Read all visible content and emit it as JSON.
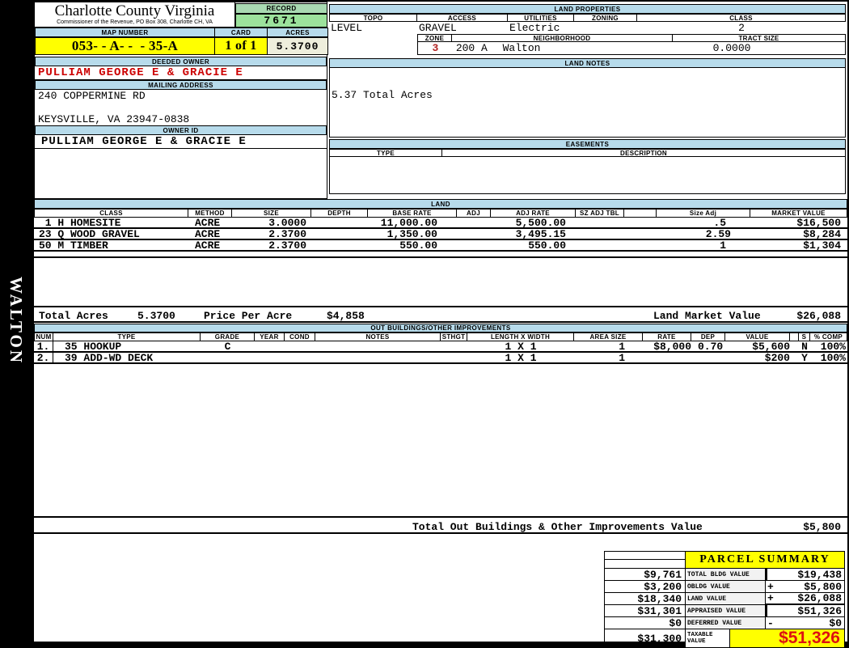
{
  "sidebar": {
    "vertical_label": "WALTON"
  },
  "header": {
    "county": "Charlotte County Virginia",
    "commissioner_line": "Commissioner of the Revenue, PO Box 308, Charlotte CH, VA",
    "record_label": "RECORD",
    "record_value": "7671",
    "map_number_label": "MAP NUMBER",
    "map_number_value": "053- - A- -  - 35-A",
    "card_label": "CARD",
    "card_value": "1 of 1",
    "acres_label": "ACRES",
    "acres_value": "5.3700"
  },
  "owner": {
    "deeded_owner_label": "DEEDED OWNER",
    "deeded_owner": "PULLIAM GEORGE E & GRACIE E",
    "mailing_address_label": "MAILING ADDRESS",
    "address_line1": "240 COPPERMINE RD",
    "address_line2": "KEYSVILLE, VA 23947-0838",
    "owner_id_label": "OWNER ID",
    "owner_id": "PULLIAM GEORGE E & GRACIE E"
  },
  "land_properties": {
    "title": "LAND PROPERTIES",
    "topo_label": "TOPO",
    "topo": "LEVEL",
    "access_label": "ACCESS",
    "access": "GRAVEL",
    "utilities_label": "UTILITIES",
    "utilities": "Electric",
    "zoning_label": "ZONING",
    "zoning": "",
    "class_label": "CLASS",
    "class": "2",
    "zone_label": "ZONE",
    "zone": "3",
    "zone_area": "200 A",
    "neighborhood_label": "NEIGHBORHOOD",
    "neighborhood": "Walton",
    "tract_size_label": "TRACT SIZE",
    "tract_size": "0.0000"
  },
  "land_notes": {
    "title": "LAND NOTES",
    "note": "5.37 Total Acres"
  },
  "easements": {
    "title": "EASEMENTS",
    "type_label": "TYPE",
    "description_label": "DESCRIPTION"
  },
  "land": {
    "title": "LAND",
    "columns": [
      "CLASS",
      "METHOD",
      "SIZE",
      "DEPTH",
      "BASE RATE",
      "ADJ",
      "ADJ RATE",
      "SZ ADJ TBL",
      "",
      "Size Adj",
      "MARKET VALUE"
    ],
    "rows": [
      {
        "class": " 1 H HOMESITE",
        "method": "ACRE",
        "size": "3.0000",
        "depth": "",
        "base_rate": "11,000.00",
        "adj": "",
        "adj_rate": "5,500.00",
        "sz_adj_tbl": "",
        "size_adj": ".5",
        "market_value": "$16,500"
      },
      {
        "class": "23 Q WOOD GRAVEL",
        "method": "ACRE",
        "size": "2.3700",
        "depth": "",
        "base_rate": "1,350.00",
        "adj": "",
        "adj_rate": "3,495.15",
        "sz_adj_tbl": "",
        "size_adj": "2.59",
        "market_value": "$8,284"
      },
      {
        "class": "50 M TIMBER",
        "method": "ACRE",
        "size": "2.3700",
        "depth": "",
        "base_rate": "550.00",
        "adj": "",
        "adj_rate": "550.00",
        "sz_adj_tbl": "",
        "size_adj": "1",
        "market_value": "$1,304"
      }
    ],
    "totals": {
      "total_acres_label": "Total Acres",
      "total_acres": "5.3700",
      "price_per_acre_label": "Price Per Acre",
      "price_per_acre": "$4,858",
      "land_market_value_label": "Land Market Value",
      "land_market_value": "$26,088"
    }
  },
  "out_buildings": {
    "title": "OUT BUILDINGS/OTHER IMPROVEMENTS",
    "columns": [
      "NUM",
      "TYPE",
      "GRADE",
      "YEAR",
      "COND",
      "NOTES",
      "STHGT",
      "LENGTH X WIDTH",
      "AREA SIZE",
      "RATE",
      "DEP",
      "VALUE",
      "",
      "S",
      "% COMP"
    ],
    "rows": [
      {
        "num": "1.",
        "type": "35 HOOKUP",
        "grade": "C",
        "year": "",
        "cond": "",
        "notes": "",
        "sthgt": "",
        "lxw": "1 X 1",
        "area_size": "1",
        "rate": "$8,000",
        "dep": "0.70",
        "value": "$5,600",
        "s": "N",
        "comp": "100%"
      },
      {
        "num": "2.",
        "type": "39 ADD-WD DECK",
        "grade": "",
        "year": "",
        "cond": "",
        "notes": "",
        "sthgt": "",
        "lxw": "1 X 1",
        "area_size": "1",
        "rate": "",
        "dep": "",
        "value": "$200",
        "s": "Y",
        "comp": "100%"
      }
    ],
    "total_label": "Total Out Buildings & Other Improvements Value",
    "total_value": "$5,800"
  },
  "parcel_summary": {
    "title": "PARCEL SUMMARY",
    "rows": [
      {
        "prior": "$9,761",
        "label": "TOTAL BLDG VALUE",
        "sign": "",
        "value": "$19,438"
      },
      {
        "prior": "$3,200",
        "label": "OBLDG VALUE",
        "sign": "+",
        "value": "$5,800"
      },
      {
        "prior": "$18,340",
        "label": "LAND VALUE",
        "sign": "+",
        "value": "$26,088"
      },
      {
        "prior": "$31,301",
        "label": "APPRAISED VALUE",
        "sign": "",
        "value": "$51,326"
      },
      {
        "prior": "$0",
        "label": "DEFERRED VALUE",
        "sign": "-",
        "value": "$0"
      }
    ],
    "taxable": {
      "prior": "$31,300",
      "label": "TAXABLE VALUE",
      "value": "$51,326"
    }
  },
  "colors": {
    "header_blue": "#B7DBEB",
    "record_green": "#9CE29C",
    "highlight_yellow": "#FFFF00",
    "acres_cream": "#EEEEDC",
    "owner_red": "#CC0000",
    "taxable_red": "#DD1111"
  }
}
